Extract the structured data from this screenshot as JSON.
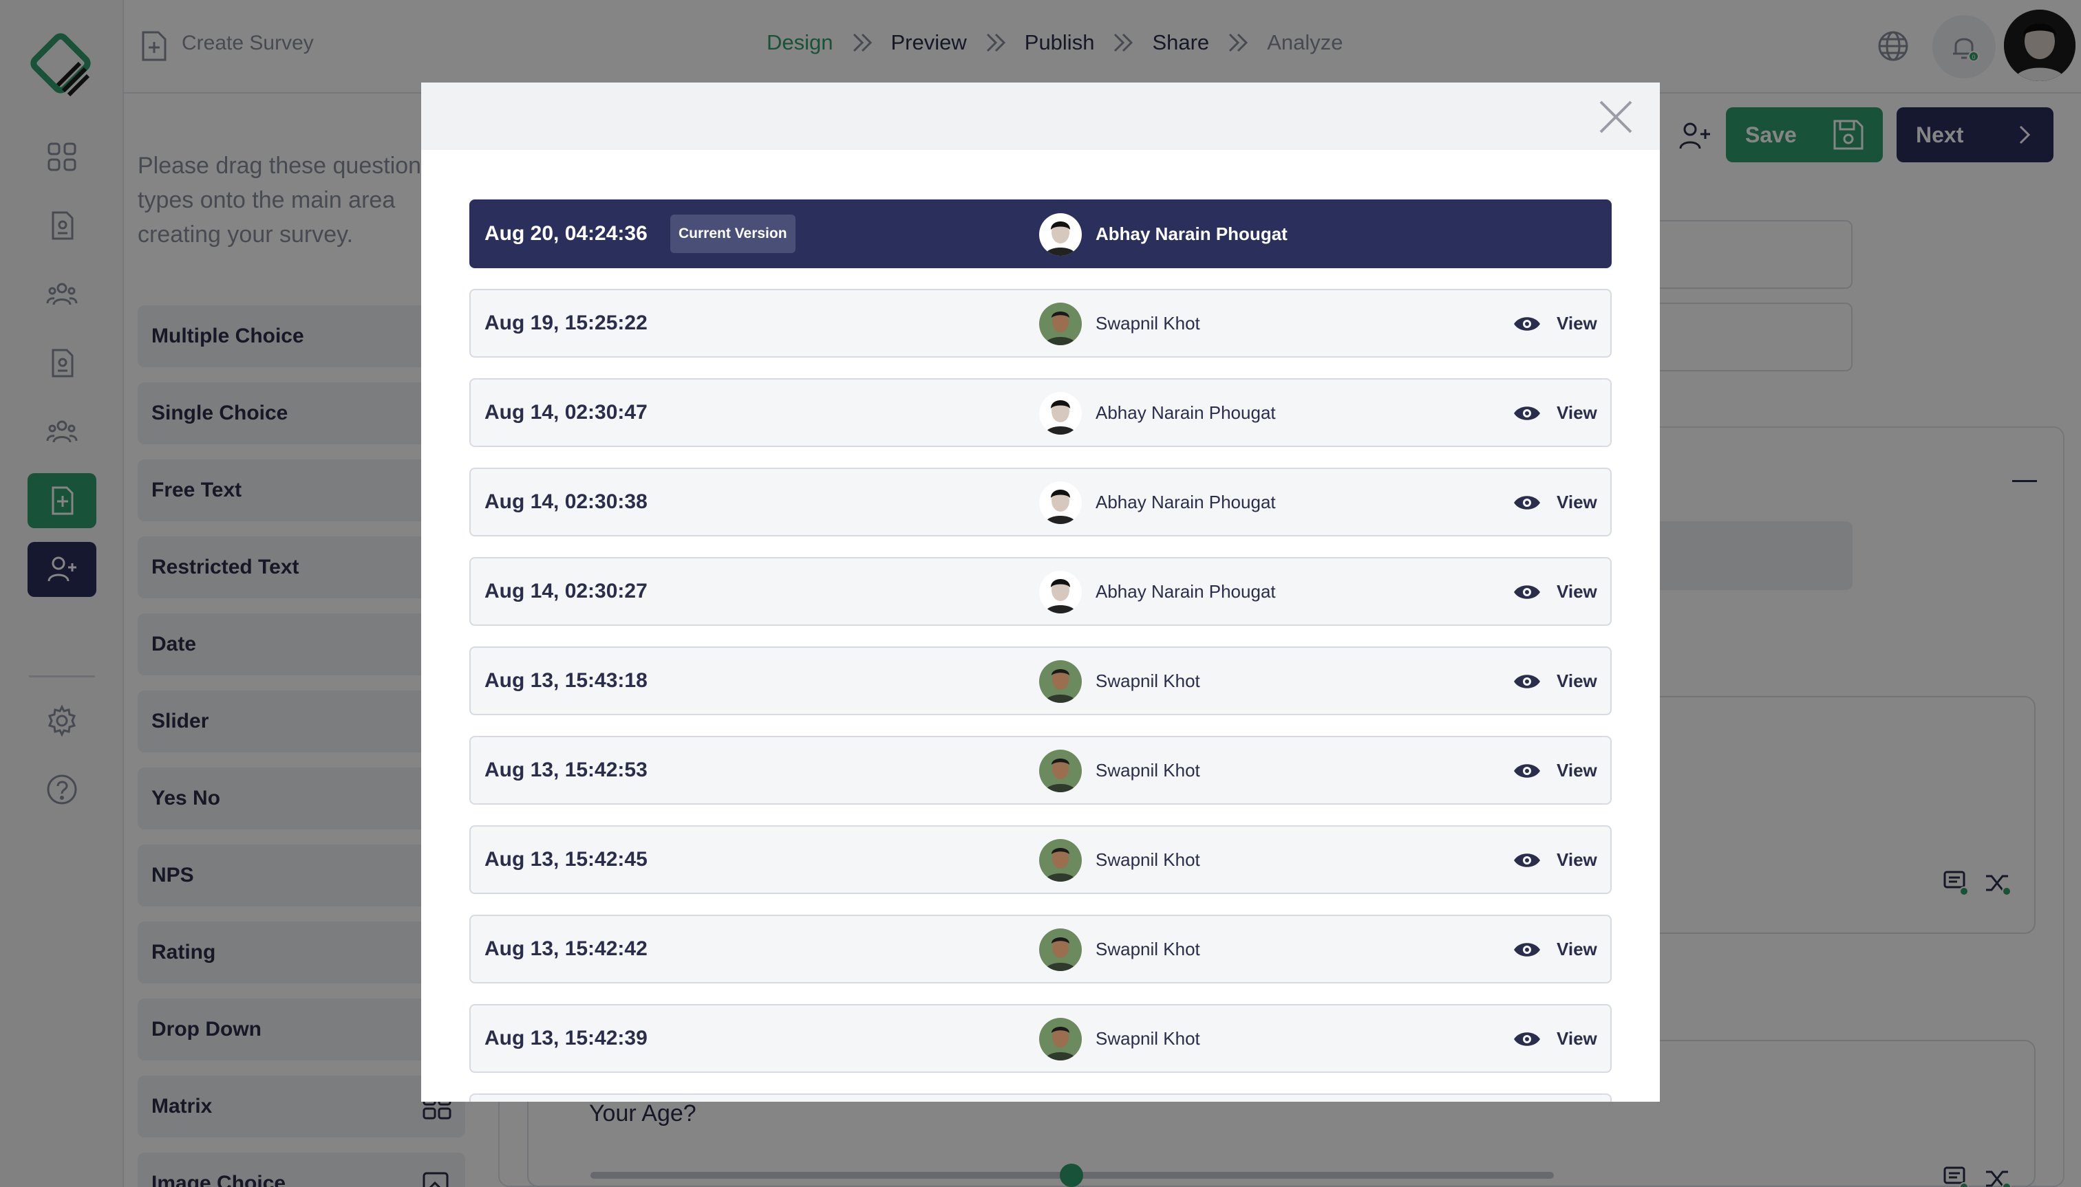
{
  "topbar": {
    "create_label": "Create Survey",
    "steps": [
      {
        "label": "Design"
      },
      {
        "label": "Preview"
      },
      {
        "label": "Publish"
      },
      {
        "label": "Share"
      },
      {
        "label": "Analyze"
      }
    ],
    "notification_count": "0"
  },
  "panel": {
    "hint": "Please drag these question types onto the main area creating your survey.",
    "question_types": [
      {
        "label": "Multiple Choice"
      },
      {
        "label": "Single Choice"
      },
      {
        "label": "Free Text"
      },
      {
        "label": "Restricted Text"
      },
      {
        "label": "Date"
      },
      {
        "label": "Slider"
      },
      {
        "label": "Yes No"
      },
      {
        "label": "NPS"
      },
      {
        "label": "Rating"
      },
      {
        "label": "Drop Down"
      },
      {
        "label": "Matrix"
      },
      {
        "label": "Image Choice"
      }
    ]
  },
  "actions": {
    "save_label": "Save",
    "next_label": "Next"
  },
  "main": {
    "age_question": "Your Age?"
  },
  "modal": {
    "current_badge": "Current Version",
    "view_label": "View",
    "versions": [
      {
        "timestamp": "Aug 20, 04:24:36",
        "user": "Abhay Narain Phougat",
        "current": true
      },
      {
        "timestamp": "Aug 19, 15:25:22",
        "user": "Swapnil Khot",
        "current": false
      },
      {
        "timestamp": "Aug 14, 02:30:47",
        "user": "Abhay Narain Phougat",
        "current": false
      },
      {
        "timestamp": "Aug 14, 02:30:38",
        "user": "Abhay Narain Phougat",
        "current": false
      },
      {
        "timestamp": "Aug 14, 02:30:27",
        "user": "Abhay Narain Phougat",
        "current": false
      },
      {
        "timestamp": "Aug 13, 15:43:18",
        "user": "Swapnil Khot",
        "current": false
      },
      {
        "timestamp": "Aug 13, 15:42:53",
        "user": "Swapnil Khot",
        "current": false
      },
      {
        "timestamp": "Aug 13, 15:42:45",
        "user": "Swapnil Khot",
        "current": false
      },
      {
        "timestamp": "Aug 13, 15:42:42",
        "user": "Swapnil Khot",
        "current": false
      },
      {
        "timestamp": "Aug 13, 15:42:39",
        "user": "Swapnil Khot",
        "current": false
      }
    ]
  },
  "colors": {
    "brand_green": "#2e9e6b",
    "navy": "#2b2f5b",
    "text": "#2b2e4a",
    "muted": "#8b8f9c"
  }
}
